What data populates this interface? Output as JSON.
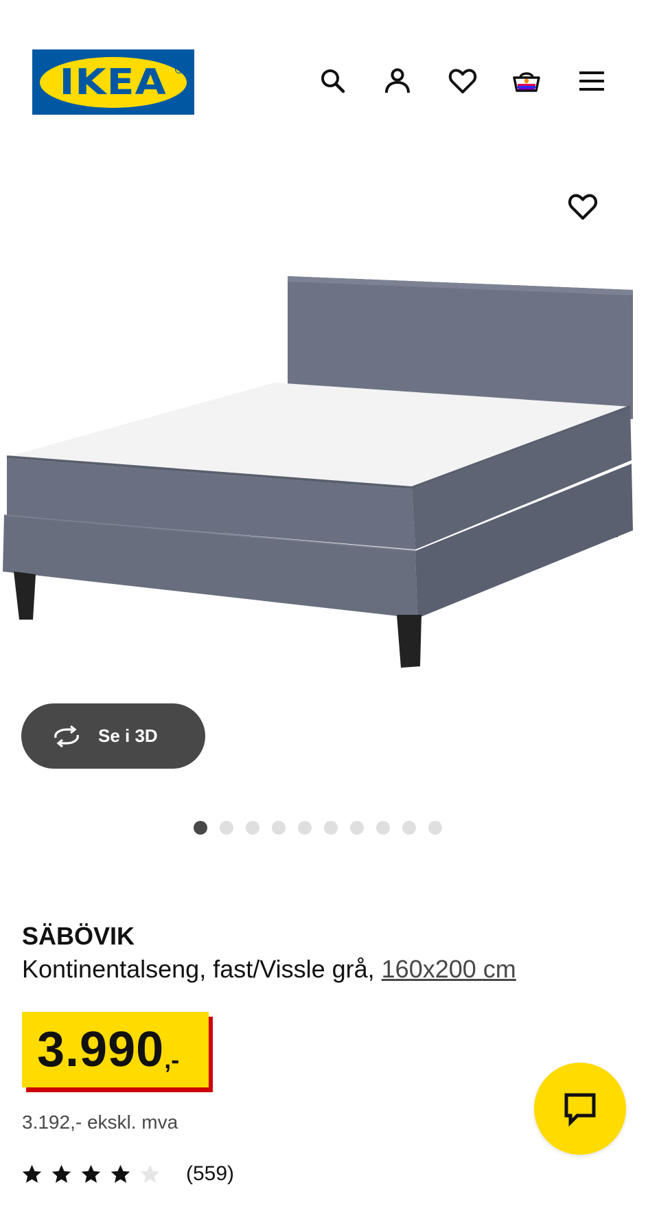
{
  "header": {
    "logo_text": "IKEA",
    "icons": [
      "search-icon",
      "account-icon",
      "heart-icon",
      "cart-icon",
      "menu-icon"
    ]
  },
  "gallery": {
    "favorite_icon": "heart-icon",
    "view_3d_label": "Se i 3D",
    "view_3d_icon": "rotate-icon",
    "dots_total": 10,
    "active_dot": 1
  },
  "product": {
    "name": "SÄBÖVIK",
    "description": "Kontinentalseng, fast/Vissle grå, ",
    "size": "160x200 cm",
    "price_integer": "3.990",
    "price_suffix": ",-",
    "price_excl_vat": "3.192,- ekskl. mva",
    "rating_stars": 4,
    "rating_max": 5,
    "review_count": "(559)"
  },
  "colors": {
    "ikea_blue": "#0058a3",
    "ikea_yellow": "#ffdb00",
    "price_red": "#cc0008",
    "dark_gray": "#484848"
  },
  "chat": {
    "icon": "chat-icon"
  }
}
